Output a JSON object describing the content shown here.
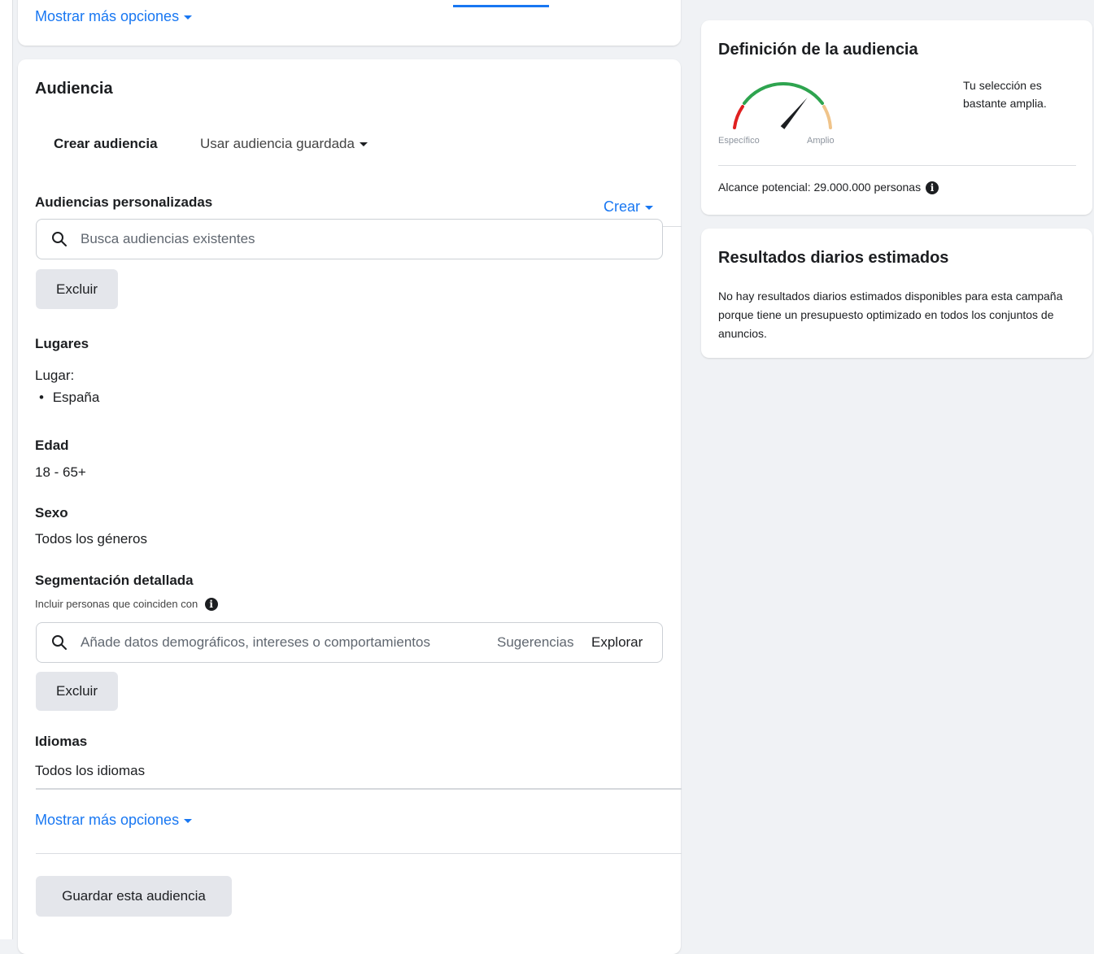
{
  "top": {
    "show_more_label": "Mostrar más opciones"
  },
  "audience": {
    "title": "Audiencia",
    "tabs": [
      {
        "label": "Crear audiencia",
        "active": true
      },
      {
        "label": "Usar audiencia guardada",
        "active": false
      }
    ],
    "custom": {
      "title": "Audiencias personalizadas",
      "create_label": "Crear",
      "search_placeholder": "Busca audiencias existentes",
      "exclude_label": "Excluir"
    },
    "places": {
      "title": "Lugares",
      "label": "Lugar:",
      "items": [
        "España"
      ]
    },
    "age": {
      "title": "Edad",
      "value": "18 - 65+"
    },
    "gender": {
      "title": "Sexo",
      "value": "Todos los géneros"
    },
    "detailed": {
      "title": "Segmentación detallada",
      "subtitle": "Incluir personas que coinciden con",
      "search_placeholder": "Añade datos demográficos, intereses o comportamientos",
      "suggestions_label": "Sugerencias",
      "explore_label": "Explorar",
      "exclude_label": "Excluir"
    },
    "languages": {
      "title": "Idiomas",
      "value": "Todos los idiomas"
    },
    "show_more_label": "Mostrar más opciones",
    "save_label": "Guardar esta audiencia"
  },
  "definition": {
    "title": "Definición de la audiencia",
    "gauge_specific": "Específico",
    "gauge_broad": "Amplio",
    "selection_text": "Tu selección es bastante amplia.",
    "reach_text": "Alcance potencial: 29.000.000 personas",
    "gauge_level": 0.72
  },
  "results": {
    "title": "Resultados diarios estimados",
    "text": "No hay resultados diarios estimados disponibles para esta campaña porque tiene un presupuesto optimizado en todos los conjuntos de anuncios."
  },
  "colors": {
    "accent": "#1877f2",
    "gauge_red": "#e02020",
    "gauge_green": "#2ea44f",
    "gauge_yellow": "#f0c48a"
  },
  "icons": {
    "search": "search-icon",
    "info": "info-icon",
    "caret": "caret-down-icon"
  }
}
